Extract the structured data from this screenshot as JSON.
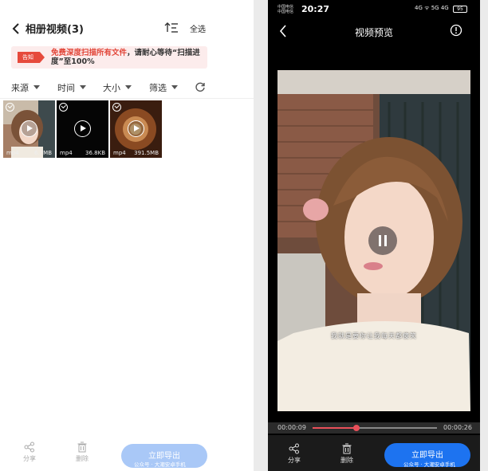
{
  "left": {
    "header": {
      "title": "相册视频(3)",
      "select_all": "全选"
    },
    "banner": {
      "tag": "告知",
      "text_red": "免费深度扫描所有文件",
      "text_rest": "，请耐心等待“扫描进度”至100%"
    },
    "filters": [
      {
        "label": "来源"
      },
      {
        "label": "时间"
      },
      {
        "label": "大小"
      },
      {
        "label": "筛选"
      }
    ],
    "videos": [
      {
        "format": "mp4",
        "size": "6.7MB"
      },
      {
        "format": "mp4",
        "size": "36.8KB"
      },
      {
        "format": "mp4",
        "size": "391.5MB"
      }
    ],
    "toolbar": {
      "share": "分享",
      "delete": "删除",
      "export": "立即导出"
    },
    "watermark": "公众号 · 大潮安卓手机"
  },
  "right": {
    "status": {
      "carrier1": "中国电信",
      "carrier2": "中国电信",
      "time": "20:27",
      "signal": "4G ᯤ 5G 4G",
      "battery": "95"
    },
    "header": {
      "title": "视频预览"
    },
    "video": {
      "subtitle": "我就是要你让我每天都傻笑",
      "current_time": "00:00:09",
      "total_time": "00:00:26",
      "progress": 0.35
    },
    "toolbar": {
      "share": "分享",
      "delete": "删除",
      "export": "立即导出"
    },
    "watermark": "公众号 · 大潮安卓手机"
  },
  "colors": {
    "accent": "#1d73f0",
    "progress": "#e9505a",
    "banner_red": "#e64a3c"
  }
}
